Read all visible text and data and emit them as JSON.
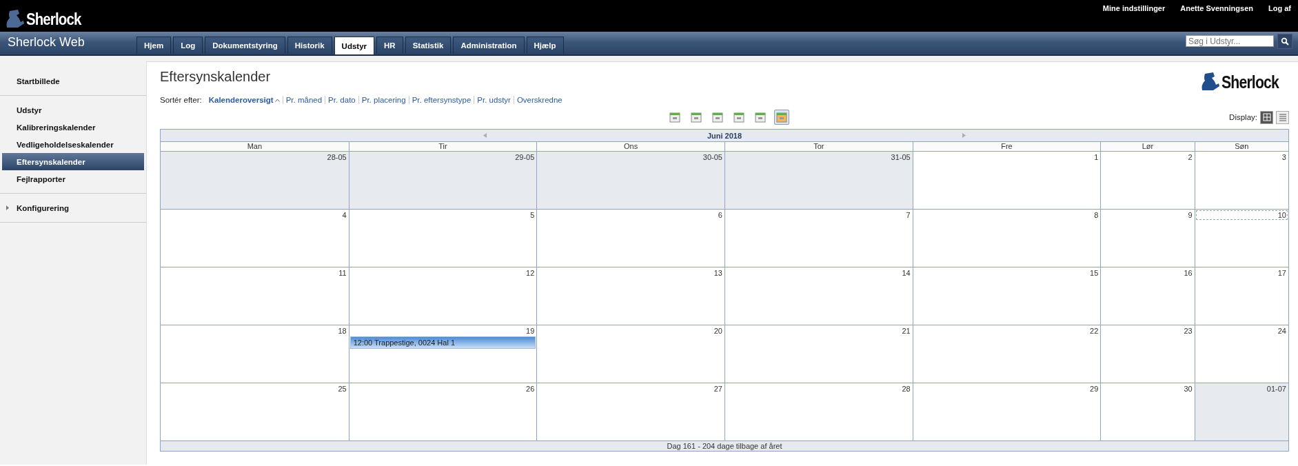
{
  "header": {
    "logo": "Sherlock",
    "links": [
      "Mine indstillinger",
      "Anette Svenningsen",
      "Log af"
    ]
  },
  "navbar": {
    "title": "Sherlock Web",
    "tabs": [
      {
        "label": "Hjem",
        "selected": false
      },
      {
        "label": "Log",
        "selected": false
      },
      {
        "label": "Dokumentstyring",
        "selected": false
      },
      {
        "label": "Historik",
        "selected": false
      },
      {
        "label": "Udstyr",
        "selected": true
      },
      {
        "label": "HR",
        "selected": false
      },
      {
        "label": "Statistik",
        "selected": false
      },
      {
        "label": "Administration",
        "selected": false
      },
      {
        "label": "Hjælp",
        "selected": false
      }
    ],
    "search": {
      "placeholder": "Søg i Udstyr..."
    }
  },
  "sidebar": {
    "groups": [
      {
        "items": [
          {
            "label": "Startbillede",
            "selected": false
          }
        ]
      },
      {
        "items": [
          {
            "label": "Udstyr",
            "selected": false
          },
          {
            "label": "Kalibreringskalender",
            "selected": false
          },
          {
            "label": "Vedligeholdelseskalender",
            "selected": false
          },
          {
            "label": "Eftersynskalender",
            "selected": true
          },
          {
            "label": "Fejlrapporter",
            "selected": false
          }
        ]
      },
      {
        "items": [
          {
            "label": "Konfigurering",
            "selected": false,
            "expanded": false
          }
        ]
      }
    ]
  },
  "page": {
    "title": "Eftersynskalender",
    "logo": "Sherlock",
    "sort_label": "Sortér efter:",
    "sort_options": [
      {
        "label": "Kalenderoversigt",
        "selected": true
      },
      {
        "label": "Pr. måned",
        "selected": false
      },
      {
        "label": "Pr. dato",
        "selected": false
      },
      {
        "label": "Pr. placering",
        "selected": false
      },
      {
        "label": "Pr. eftersynstype",
        "selected": false
      },
      {
        "label": "Pr. udstyr",
        "selected": false
      },
      {
        "label": "Overskredne",
        "selected": false
      }
    ],
    "view_buttons": [
      {
        "selected": false
      },
      {
        "selected": false
      },
      {
        "selected": false
      },
      {
        "selected": false
      },
      {
        "selected": false
      },
      {
        "selected": true
      }
    ],
    "display_label": "Display:",
    "display_buttons": [
      {
        "kind": "grid",
        "selected": true
      },
      {
        "kind": "list",
        "selected": false
      }
    ]
  },
  "calendar": {
    "month": "Juni 2018",
    "weekdays": [
      "Man",
      "Tir",
      "Ons",
      "Tor",
      "Fre",
      "Lør",
      "Søn"
    ],
    "weeks": [
      [
        {
          "label": "28-05",
          "outside": true,
          "today": false
        },
        {
          "label": "29-05",
          "outside": true,
          "today": false
        },
        {
          "label": "30-05",
          "outside": true,
          "today": false
        },
        {
          "label": "31-05",
          "outside": true,
          "today": false
        },
        {
          "label": "1",
          "outside": false,
          "today": false
        },
        {
          "label": "2",
          "outside": false,
          "today": false
        },
        {
          "label": "3",
          "outside": false,
          "today": false
        }
      ],
      [
        {
          "label": "4",
          "outside": false,
          "today": false
        },
        {
          "label": "5",
          "outside": false,
          "today": false
        },
        {
          "label": "6",
          "outside": false,
          "today": false
        },
        {
          "label": "7",
          "outside": false,
          "today": false
        },
        {
          "label": "8",
          "outside": false,
          "today": false
        },
        {
          "label": "9",
          "outside": false,
          "today": false
        },
        {
          "label": "10",
          "outside": false,
          "today": true
        }
      ],
      [
        {
          "label": "11",
          "outside": false,
          "today": false
        },
        {
          "label": "12",
          "outside": false,
          "today": false
        },
        {
          "label": "13",
          "outside": false,
          "today": false
        },
        {
          "label": "14",
          "outside": false,
          "today": false
        },
        {
          "label": "15",
          "outside": false,
          "today": false
        },
        {
          "label": "16",
          "outside": false,
          "today": false
        },
        {
          "label": "17",
          "outside": false,
          "today": false
        }
      ],
      [
        {
          "label": "18",
          "outside": false,
          "today": false
        },
        {
          "label": "19",
          "outside": false,
          "today": false,
          "events": [
            "12:00 Trappestige, 0024 Hal 1"
          ]
        },
        {
          "label": "20",
          "outside": false,
          "today": false
        },
        {
          "label": "21",
          "outside": false,
          "today": false
        },
        {
          "label": "22",
          "outside": false,
          "today": false
        },
        {
          "label": "23",
          "outside": false,
          "today": false
        },
        {
          "label": "24",
          "outside": false,
          "today": false
        }
      ],
      [
        {
          "label": "25",
          "outside": false,
          "today": false
        },
        {
          "label": "26",
          "outside": false,
          "today": false
        },
        {
          "label": "27",
          "outside": false,
          "today": false
        },
        {
          "label": "28",
          "outside": false,
          "today": false
        },
        {
          "label": "29",
          "outside": false,
          "today": false
        },
        {
          "label": "30",
          "outside": false,
          "today": false
        },
        {
          "label": "01-07",
          "outside": true,
          "today": false
        }
      ]
    ],
    "footer": "Dag 161 - 204 dage tilbage af året"
  }
}
